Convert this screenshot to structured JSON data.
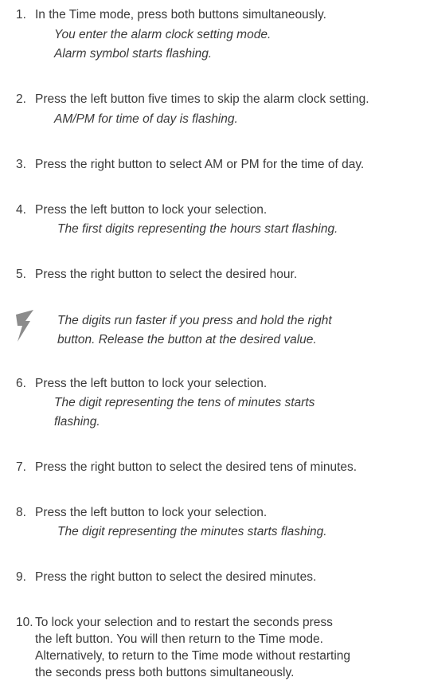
{
  "steps": [
    {
      "number": "1.",
      "text": "In the Time mode, press both buttons simultaneously.",
      "notes": [
        "You enter the alarm clock setting mode.",
        "Alarm symbol starts flashing."
      ]
    },
    {
      "number": "2.",
      "text": "Press the left button five times to skip the alarm clock setting.",
      "notes": [
        "AM/PM for time of day is flashing."
      ]
    },
    {
      "number": "3.",
      "text": "Press the right button to select AM or PM for the time of day.",
      "notes": []
    },
    {
      "number": "4.",
      "text": "Press the left button to lock your selection.",
      "notes": [
        "The first digits representing the hours start flashing."
      ]
    },
    {
      "number": "5.",
      "text": "Press the right button to select the desired hour.",
      "notes": []
    },
    {
      "number": "6.",
      "text": "Press the left button to lock your selection.",
      "notes": [
        "The digit representing the tens of minutes starts",
        "flashing."
      ]
    },
    {
      "number": "7.",
      "text": "Press the right button to select the desired tens of minutes.",
      "notes": []
    },
    {
      "number": "8.",
      "text": "Press the left button to lock your selection.",
      "notes": [
        "The digit representing the minutes starts flashing."
      ]
    },
    {
      "number": "9.",
      "text": "Press the right button to select the desired minutes.",
      "notes": []
    },
    {
      "number": "10.",
      "lines": [
        "To lock your selection and to restart the seconds press",
        "the left button. You will then return to the Time mode.",
        "Alternatively, to return to the Time mode without restarting",
        "the seconds press both buttons simultaneously."
      ]
    }
  ],
  "tip": {
    "icon": "lightning-bolt-icon",
    "lines": [
      "The digits run faster if you press and hold the right",
      "button. Release the button at the desired value."
    ]
  },
  "colors": {
    "text": "#3a3a3a",
    "icon": "#8c8c8c"
  }
}
